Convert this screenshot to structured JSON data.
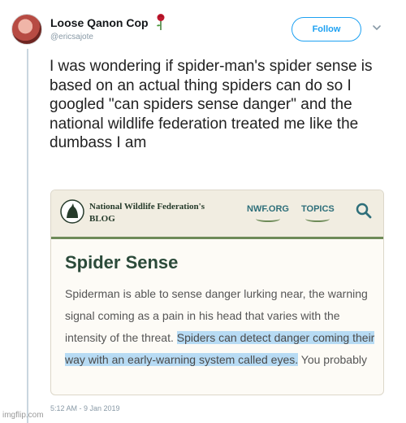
{
  "tweet": {
    "display_name": "Loose Qanon Cop",
    "handle": "@ericsajote",
    "follow_label": "Follow",
    "text": "I was wondering if spider-man's spider sense is based on an actual thing spiders can do so I googled \"can spiders sense danger\" and the national wildlife federation treated me like the dumbass I am",
    "timestamp": "5:12 AM - 9 Jan 2019"
  },
  "card": {
    "brand_line1": "National Wildlife Federation's",
    "brand_line2": "BLOG",
    "nav": [
      "NWF.ORG",
      "TOPICS"
    ],
    "article_title": "Spider Sense",
    "body_plain": "Spiderman is able to sense danger lurking near, the warning signal coming as a pain in his head that varies with the intensity of the threat.",
    "body_highlighted": "Spiders can detect danger coming their way with an early-warning system called eyes.",
    "body_tail": "You probably"
  },
  "watermark": "imgflip.com",
  "colors": {
    "accent": "#1da1f2",
    "highlight": "#b7dbf4",
    "nwf_green": "#6e8b58",
    "nwf_teal": "#2e6f7a"
  },
  "icons": [
    "rose-icon",
    "chevron-down-icon",
    "nwf-logo-icon",
    "search-icon"
  ]
}
